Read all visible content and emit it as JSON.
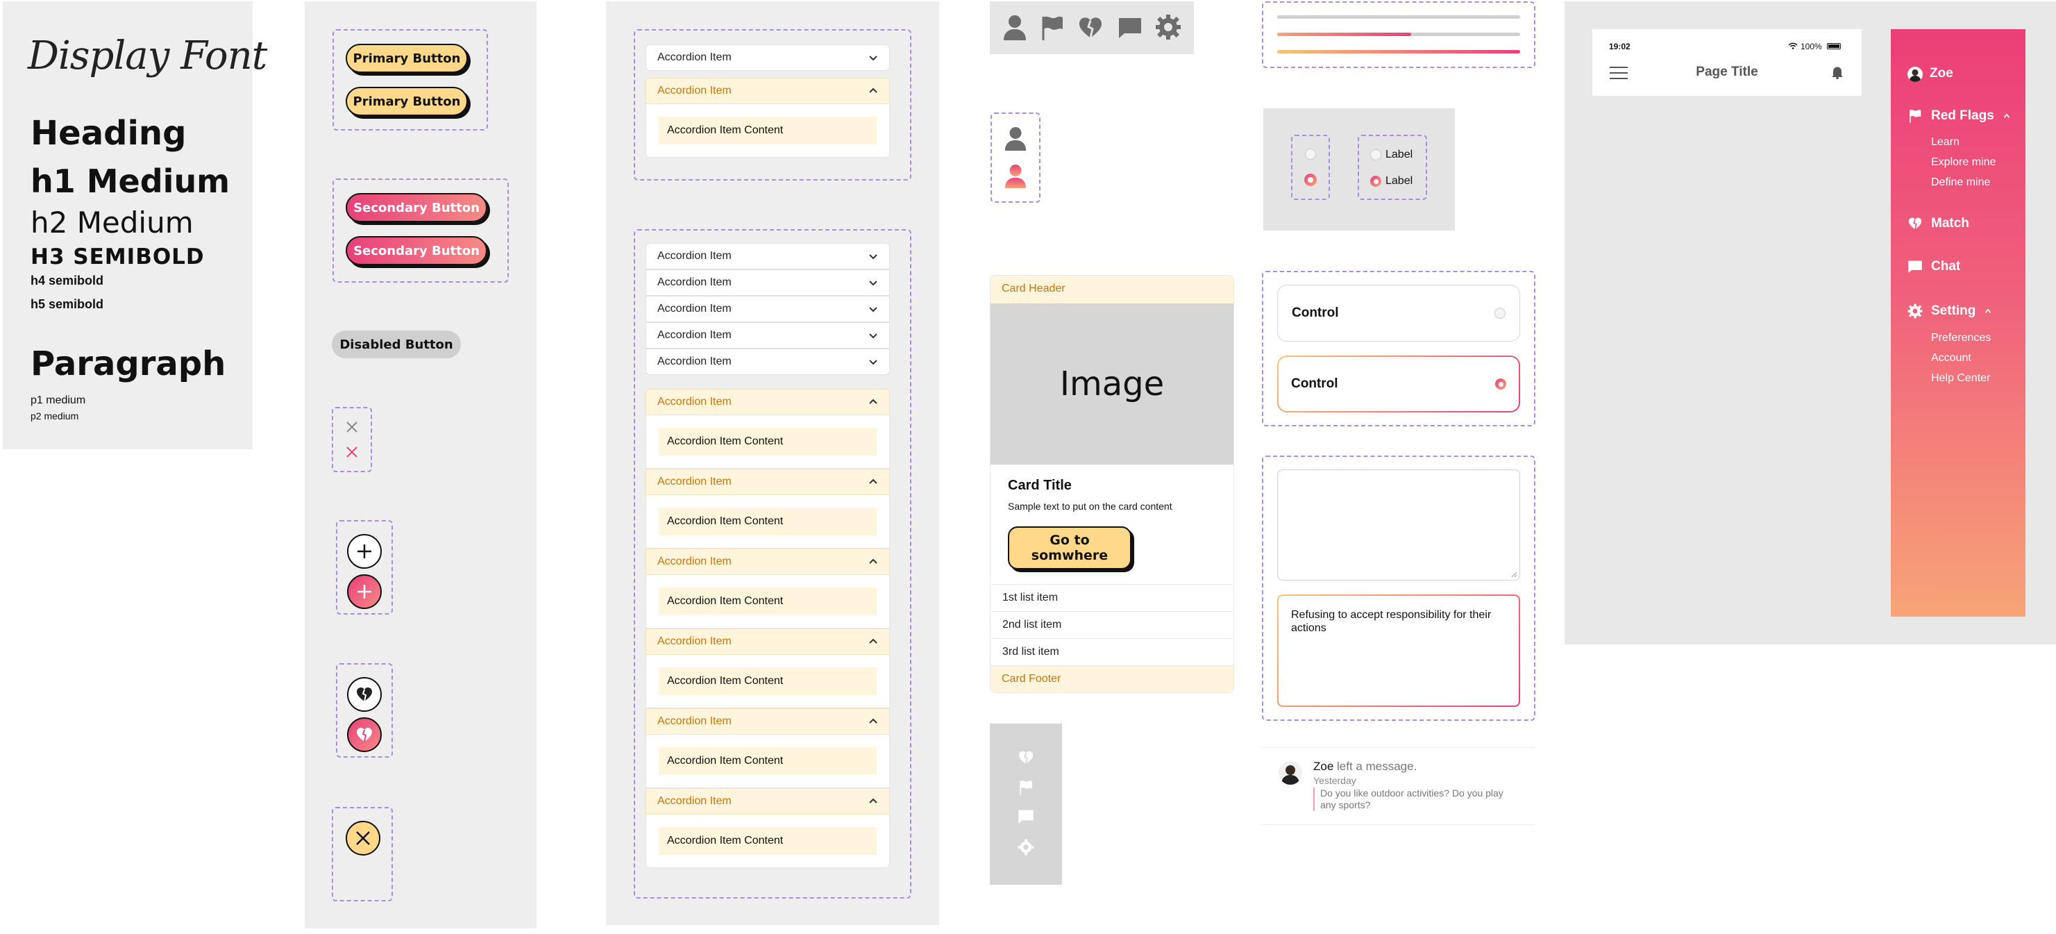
{
  "typography": {
    "display": "Display Font",
    "heading": "Heading",
    "h1": "h1 Medium",
    "h2": "h2 Medium",
    "h3": "H3 SEMIBOLD",
    "h4": "h4 semibold",
    "h5": "h5 semibold",
    "paragraph": "Paragraph",
    "p1": "p1 medium",
    "p2": "p2 medium"
  },
  "buttons": {
    "primary": "Primary Button",
    "secondary": "Secondary Button",
    "disabled": "Disabled Button"
  },
  "accordion": {
    "item": "Accordion Item",
    "content": "Accordion Item Content"
  },
  "card": {
    "header": "Card Header",
    "image": "Image",
    "title": "Card Title",
    "text": "Sample text to put on the card content",
    "button_line1": "Go to",
    "button_line2": "somwhere",
    "list": [
      "1st list item",
      "2nd list item",
      "3rd list item"
    ],
    "footer": "Card Footer"
  },
  "radios": {
    "label": "Label"
  },
  "controls": {
    "label": "Control"
  },
  "textarea": {
    "filled_value": "Refusing to accept responsibility for their actions"
  },
  "progress": {
    "bar2_fraction": 0.55,
    "bar3_fraction": 1.0
  },
  "notification": {
    "name": "Zoe",
    "action": "left a message.",
    "time": "Yesterday",
    "message": "Do you like outdoor activities? Do you play any sports?"
  },
  "phone": {
    "time": "19:02",
    "battery": "100%",
    "title": "Page Title"
  },
  "sidebar": {
    "user": "Zoe",
    "red_flags": "Red Flags",
    "red_flags_items": [
      "Learn",
      "Explore mine",
      "Define mine"
    ],
    "match": "Match",
    "chat": "Chat",
    "setting": "Setting",
    "setting_items": [
      "Preferences",
      "Account",
      "Help Center"
    ]
  },
  "colors": {
    "accent_pink": "#e8407a",
    "accent_peach": "#f7a477",
    "primary_yellow": "#ffd88a",
    "accordion_open_text": "#c8760a",
    "dash_purple": "#a98ee0"
  },
  "icons": [
    "user-icon",
    "flag-icon",
    "heart-icon",
    "chat-icon",
    "gear-icon",
    "close-icon",
    "plus-icon",
    "bell-icon",
    "menu-icon"
  ]
}
